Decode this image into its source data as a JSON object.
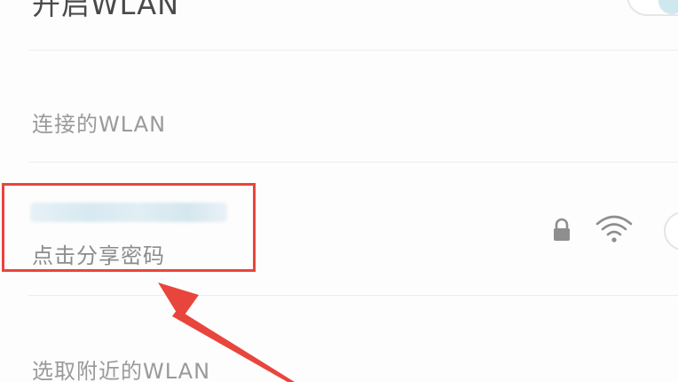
{
  "wlan_toggle": {
    "label": "开启WLAN",
    "state": "on"
  },
  "connected_section": {
    "header": "连接的WLAN"
  },
  "connected_network": {
    "ssid": "",
    "subtitle": "点击分享密码",
    "secured": true,
    "signal": "full"
  },
  "nearby_section": {
    "header": "选取附近的WLAN"
  },
  "colors": {
    "highlight": "#e8453c",
    "arrow": "#e8453c",
    "toggle_accent": "#cfe8ef"
  },
  "icons": {
    "lock": "lock-icon",
    "wifi": "wifi-signal-icon",
    "detail": "detail-button-icon"
  }
}
